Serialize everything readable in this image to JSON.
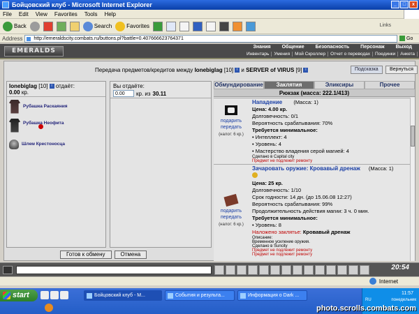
{
  "window": {
    "title": "Бойцовский клуб - Microsoft Internet Explorer"
  },
  "menu": [
    "File",
    "Edit",
    "View",
    "Favorites",
    "Tools",
    "Help"
  ],
  "toolbar": {
    "back": "Back",
    "search": "Search",
    "favorites": "Favorites",
    "links": "Links"
  },
  "address": {
    "label": "Address",
    "url": "http://emeraldscity.combats.ru/buttons.pl?battle=0.407666623764371",
    "go": "Go"
  },
  "game": {
    "logo": "EMERALDS",
    "top_nav": [
      "Знания",
      "Общение",
      "Безопасность",
      "Персонаж",
      "Выход"
    ],
    "sub_nav": [
      "Инвентарь",
      "Умения",
      "Мой Скроллер",
      "Отчет о переводах",
      "Поединки",
      "Анкета"
    ]
  },
  "transfer": {
    "title_prefix": "Передача предметов/кредитов между",
    "player1": "Ionebiglag",
    "player1_level": "[10]",
    "and": "и",
    "player2": "SERVER of VIRUS",
    "player2_level": "[9]",
    "badge": "i",
    "hint_button": "Подсказка",
    "back_button": "Вернуться"
  },
  "left_panel": {
    "player": "Ionebiglag",
    "level": "[10]",
    "gives": "отдаёт:",
    "amount": "0.00",
    "currency": "кр.",
    "items": [
      {
        "name": "Рубашка Раскаяния",
        "icon": "shirt-icon"
      },
      {
        "name": "Рубашка Неофита",
        "icon": "shirt-icon"
      },
      {
        "name": "Шлем Крестоносца",
        "icon": "helmet-icon"
      }
    ]
  },
  "middle_panel": {
    "you_give": "Вы отдаёте:",
    "input_value": "0.00",
    "of_text": "кр. из",
    "total": "30.11"
  },
  "actions": {
    "ready": "Готов к обмену",
    "cancel": "Отмена"
  },
  "right_panel": {
    "tabs": [
      "Обмундирование",
      "Заклятия",
      "Эликсиры",
      "Прочее"
    ],
    "active_tab": 1,
    "backpack": "Рюкзак (масса: 222.1/413)",
    "items": [
      {
        "name": "Нападение",
        "mass": "(Масса: 1)",
        "price": "Цена: 4.00 кр.",
        "durability": "Долговечность: 0/1",
        "chance": "Вероятность срабатывания: 70%",
        "req_title": "Требуется минимальное:",
        "reqs": [
          "Интеллект: 4",
          "Уровень: 4",
          "Мастерство владения серой магией: 4"
        ],
        "made": "Сделано в Capital city",
        "note": "Предмет не подлежит ремонту",
        "gift": "подарить",
        "transfer": "передать",
        "tax": "(налог: 6 кр.)"
      },
      {
        "name": "Зачаровать оружие: Кровавый дренаж",
        "mass": "(Масса: 1)",
        "price": "Цена: 25 кр.",
        "durability": "Долговечность: 1/10",
        "expiry": "Срок годности: 14 дн. (до 15.06.08 12:27)",
        "chance": "Вероятность срабатывания: 99%",
        "duration": "Продолжительность действия магии: 3 ч. 0 мин.",
        "req_title": "Требуется минимальное:",
        "reqs": [
          "Уровень: 8"
        ],
        "spell_label": "Наложено заклятье:",
        "spell_name": "Кровавый дренаж",
        "desc_label": "Описание:",
        "desc": "Временное усиление оружия.",
        "made": "Сделано в Suncity",
        "note": "Предмет не подлежит ремонту",
        "note2": "Предмет не подлежит ремонту",
        "gift": "подарить",
        "transfer": "передать",
        "tax": "(налог: 6 кр.)"
      }
    ]
  },
  "chat": {
    "clock": "20:54"
  },
  "status": {
    "zone": "Internet"
  },
  "taskbar": {
    "start": "start",
    "tasks": [
      "Бойцовский клуб - M...",
      "События и результа...",
      "Информация о Dark ..."
    ],
    "lang": "RU",
    "time": "11:57",
    "day": "понедельник"
  },
  "watermark": "photo.scrolls.combats.com"
}
